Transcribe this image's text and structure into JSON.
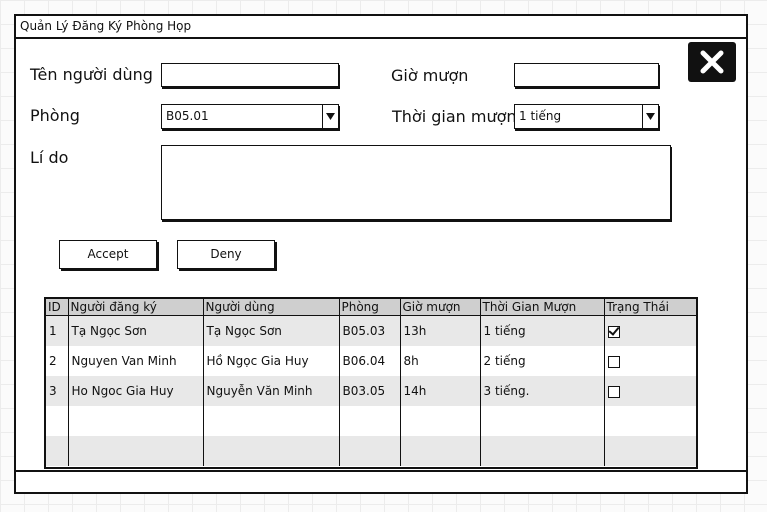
{
  "window": {
    "title": "Quản Lý Đăng Ký Phòng Họp"
  },
  "form": {
    "user_label": "Tên người dùng",
    "user_value": "",
    "time_label": "Giờ mượn",
    "time_value": "",
    "room_label": "Phòng",
    "room_value": "B05.01",
    "duration_label": "Thời gian mượn",
    "duration_value": "1 tiếng",
    "reason_label": "Lí do",
    "reason_value": ""
  },
  "buttons": {
    "accept": "Accept",
    "deny": "Deny"
  },
  "table": {
    "columns": [
      "ID",
      "Người đăng ký",
      "Người dùng",
      "Phòng",
      "Giờ mượn",
      "Thời Gian Mượn",
      "Trạng Thái"
    ],
    "rows": [
      {
        "id": "1",
        "registrant": "Tạ Ngọc Sơn",
        "user": "Tạ Ngọc Sơn",
        "room": "B05.03",
        "time": "13h",
        "duration": "1 tiếng",
        "status_checked": true
      },
      {
        "id": "2",
        "registrant": "Nguyen Van Minh",
        "user": "Hồ Ngọc Gia Huy",
        "room": "B06.04",
        "time": "8h",
        "duration": "2 tiếng",
        "status_checked": false
      },
      {
        "id": "3",
        "registrant": "Ho Ngoc Gia Huy",
        "user": "Nguyễn Văn Minh",
        "room": "B03.05",
        "time": "14h",
        "duration": "3 tiếng.",
        "status_checked": false
      }
    ]
  },
  "icons": {
    "close": "close-icon",
    "dropdown": "chevron-down-icon",
    "checkbox": "checkbox-icon"
  }
}
